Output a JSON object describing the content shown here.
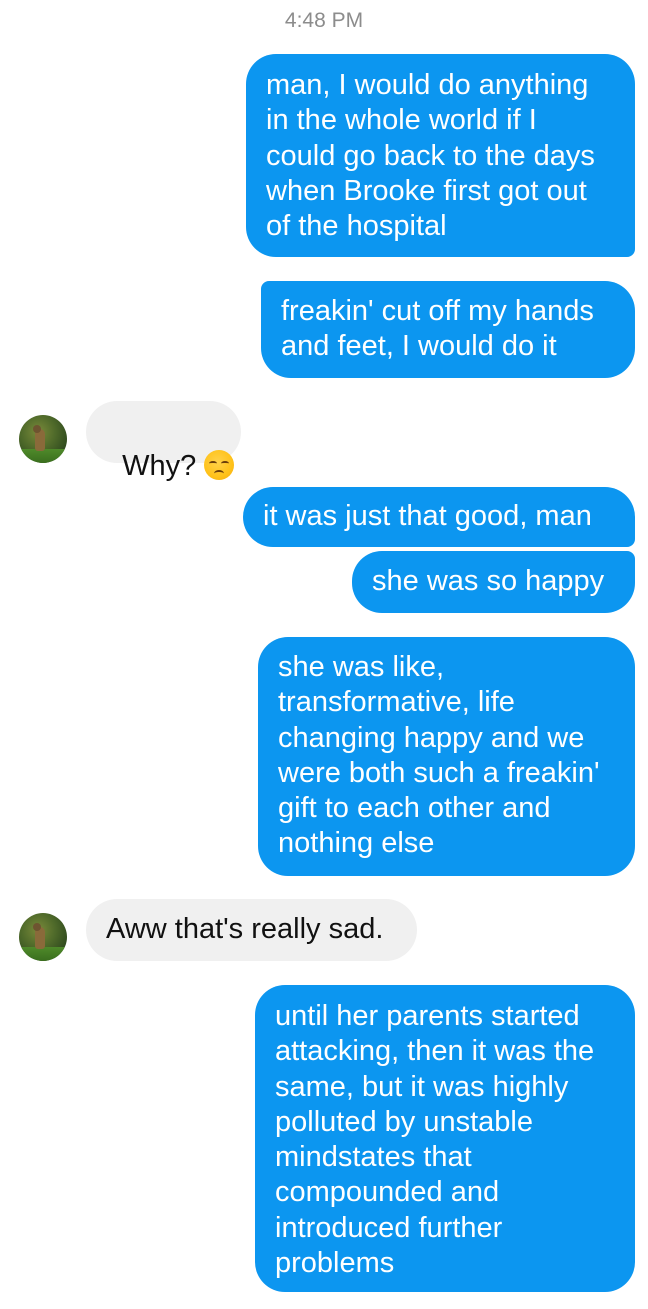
{
  "conversation": {
    "timestamp": "4:48 PM",
    "messages": [
      {
        "direction": "outgoing",
        "text": "man, I would do anything\nin the whole world if I\ncould go back to the days\nwhen Brooke first got out\nof the hospital"
      },
      {
        "direction": "outgoing",
        "text": "freakin' cut off my hands\nand feet, I would do it"
      },
      {
        "direction": "incoming",
        "text": "Why?",
        "emoji": "disappointed-face-icon"
      },
      {
        "direction": "outgoing",
        "text": "it was just that good, man"
      },
      {
        "direction": "outgoing",
        "text": "she was so happy"
      },
      {
        "direction": "outgoing",
        "text": "she was like,\ntransformative, life\nchanging happy and we\nwere both such a freakin'\ngift to each other and\nnothing else"
      },
      {
        "direction": "incoming",
        "text": "Aww that's really sad."
      },
      {
        "direction": "outgoing",
        "text": "until her parents started\nattacking, then it was the\nsame, but it was highly\npolluted by unstable\nmindstates that\ncompounded and\nintroduced further\nproblems"
      }
    ]
  },
  "colors": {
    "outgoing_bubble": "#0c96f0",
    "incoming_bubble": "#f0f0f0",
    "timestamp_text": "#8c8c8c"
  }
}
